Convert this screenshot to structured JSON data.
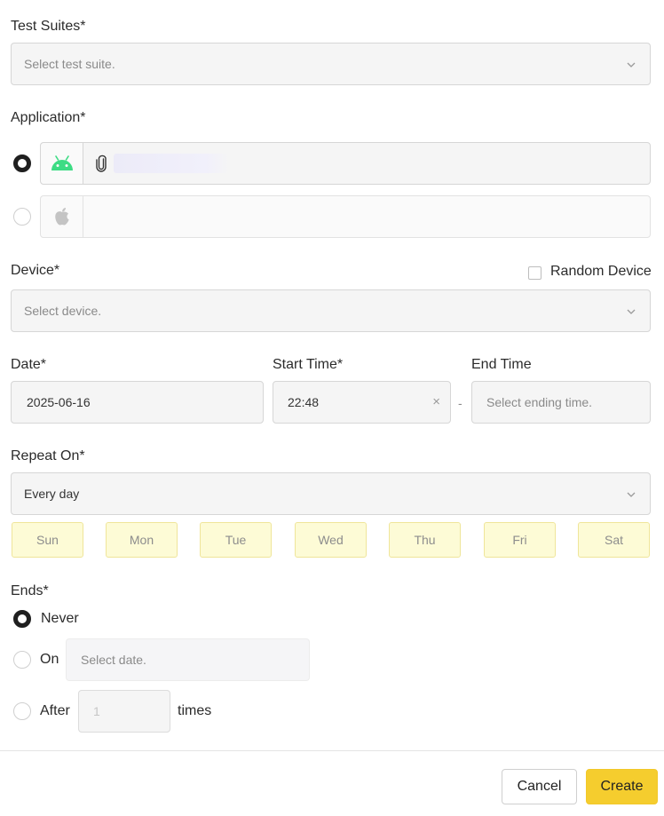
{
  "test_suites": {
    "label": "Test Suites*",
    "placeholder": "Select test suite."
  },
  "application": {
    "label": "Application*",
    "android_file": "",
    "ios_file": ""
  },
  "device": {
    "label": "Device*",
    "placeholder": "Select device.",
    "random_label": "Random Device"
  },
  "date": {
    "label": "Date*",
    "value": "2025-06-16"
  },
  "start_time": {
    "label": "Start Time*",
    "value": "22:48",
    "clear": "×"
  },
  "separator": "-",
  "end_time": {
    "label": "End Time",
    "placeholder": "Select ending time."
  },
  "repeat": {
    "label": "Repeat On*",
    "value": "Every day",
    "days": [
      "Sun",
      "Mon",
      "Tue",
      "Wed",
      "Thu",
      "Fri",
      "Sat"
    ]
  },
  "ends": {
    "label": "Ends*",
    "never": "Never",
    "on": "On",
    "on_placeholder": "Select date.",
    "after": "After",
    "after_value": "1",
    "times": "times"
  },
  "footer": {
    "cancel": "Cancel",
    "create": "Create"
  },
  "colors": {
    "android_green": "#3ddc84",
    "accent_yellow": "#f5cd2e",
    "day_bg": "#fdfbd6"
  }
}
